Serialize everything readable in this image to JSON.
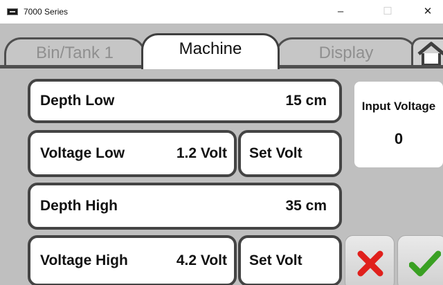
{
  "window": {
    "title": "7000 Series",
    "minimize": "–",
    "maximize": "☐",
    "close": "✕"
  },
  "tabs": [
    {
      "label": "Bin/Tank 1",
      "active": false
    },
    {
      "label": "Machine",
      "active": true
    },
    {
      "label": "Display",
      "active": false
    }
  ],
  "fields": {
    "depth_low": {
      "label": "Depth  Low",
      "value": "15  cm"
    },
    "voltage_low": {
      "label": "Voltage  Low",
      "value": "1.2 Volt",
      "button": "Set Volt"
    },
    "depth_high": {
      "label": "Depth  High",
      "value": "35  cm"
    },
    "voltage_high": {
      "label": "Voltage  High",
      "value": "4.2 Volt",
      "button": "Set Volt"
    }
  },
  "input_voltage": {
    "title": "Input Voltage",
    "value": "0"
  },
  "actions": {
    "cancel_icon": "red-x-icon",
    "confirm_icon": "green-check-icon"
  },
  "colors": {
    "cancel": "#e0201c",
    "confirm": "#3aa023",
    "panel_bg": "#bfbfbf"
  }
}
